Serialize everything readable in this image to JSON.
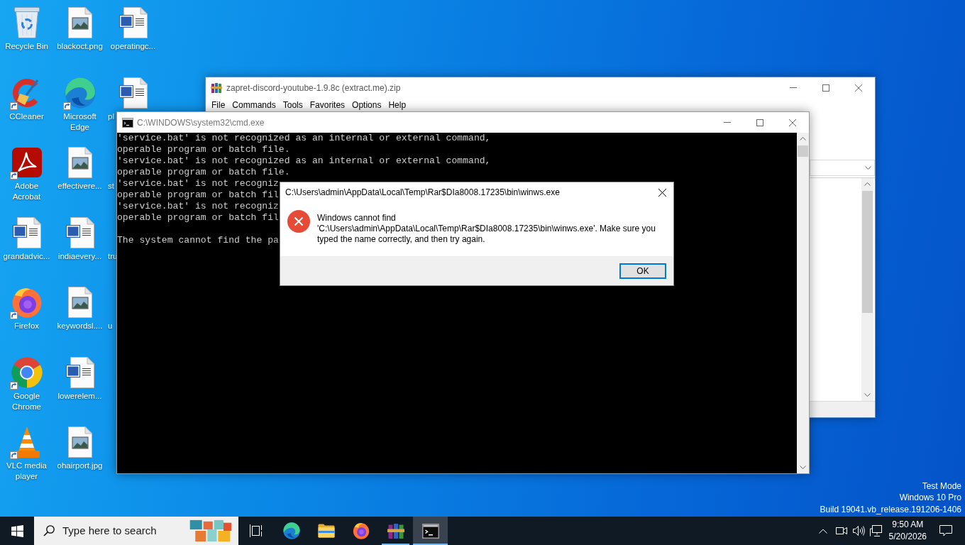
{
  "desktop": {
    "icons": [
      {
        "label": "Recycle Bin",
        "kind": "recycle-bin",
        "shortcut": false,
        "covered": false
      },
      {
        "label": "CCleaner",
        "kind": "ccleaner",
        "shortcut": true,
        "covered": false
      },
      {
        "label": "Adobe Acrobat",
        "kind": "acrobat",
        "shortcut": true,
        "covered": false
      },
      {
        "label": "grandadvic...",
        "kind": "document",
        "shortcut": false,
        "covered": false
      },
      {
        "label": "Firefox",
        "kind": "firefox",
        "shortcut": true,
        "covered": false
      },
      {
        "label": "Google Chrome",
        "kind": "chrome",
        "shortcut": true,
        "covered": false
      },
      {
        "label": "VLC media player",
        "kind": "vlc",
        "shortcut": true,
        "covered": false
      },
      {
        "label": "blackoct.png",
        "kind": "image",
        "shortcut": false,
        "covered": false
      },
      {
        "label": "Microsoft Edge",
        "kind": "edge",
        "shortcut": true,
        "covered": false
      },
      {
        "label": "effectivere...",
        "kind": "image",
        "shortcut": false,
        "covered": false
      },
      {
        "label": "indiaevery...",
        "kind": "document",
        "shortcut": false,
        "covered": false
      },
      {
        "label": "keywordsl....",
        "kind": "image",
        "shortcut": false,
        "covered": false
      },
      {
        "label": "lowerelem...",
        "kind": "document",
        "shortcut": false,
        "covered": false
      },
      {
        "label": "ohairport.jpg",
        "kind": "image",
        "shortcut": false,
        "covered": false
      },
      {
        "label": "operatingc...",
        "kind": "document",
        "shortcut": false,
        "covered": false
      },
      {
        "label": "pl",
        "kind": "document",
        "shortcut": false,
        "covered": true
      },
      {
        "label": "st",
        "kind": "unknown",
        "shortcut": false,
        "covered": true
      },
      {
        "label": "tru",
        "kind": "unknown",
        "shortcut": false,
        "covered": true
      },
      {
        "label": "u",
        "kind": "unknown",
        "shortcut": false,
        "covered": true
      }
    ],
    "system_info": [
      "Test Mode",
      "Windows 10 Pro",
      "Build 19041.vb_release.191206-1406"
    ]
  },
  "archive_window": {
    "title": "zapret-discord-youtube-1.9.8c (extract.me).zip",
    "active": false,
    "menu": [
      "File",
      "Commands",
      "Tools",
      "Favorites",
      "Options",
      "Help"
    ]
  },
  "console_window": {
    "title": "C:\\WINDOWS\\system32\\cmd.exe",
    "active": false,
    "output": [
      {
        "lines": [
          "'service.bat' is not recognized as an internal or external command,",
          "operable program or batch file.",
          "'service.bat' is not recognized as an internal or external command,",
          "operable program or batch file.",
          "'service.bat' is not recogniz",
          "operable program or batch fil",
          "'service.bat' is not recogniz",
          "operable program or batch fil"
        ]
      },
      {
        "lines": [
          "The system cannot find the pa"
        ]
      }
    ]
  },
  "error_dialog": {
    "title": "C:\\Users\\admin\\AppData\\Local\\Temp\\Rar$DIa8008.17235\\bin\\winws.exe",
    "active": true,
    "message": "Windows cannot find 'C:\\Users\\admin\\AppData\\Local\\Temp\\Rar$DIa8008.17235\\bin\\winws.exe'. Make sure you typed the name correctly, and then try again.",
    "buttons": [
      {
        "label": "OK",
        "focused": true
      }
    ]
  },
  "taskbar": {
    "search": {
      "placeholder": "Type here to search"
    },
    "apps": [
      {
        "kind": "task-view",
        "running": false,
        "active": false
      },
      {
        "kind": "edge",
        "running": false,
        "active": false
      },
      {
        "kind": "explorer",
        "running": false,
        "active": false
      },
      {
        "kind": "firefox",
        "running": false,
        "active": false
      },
      {
        "kind": "winrar",
        "running": true,
        "active": false
      },
      {
        "kind": "terminal",
        "running": true,
        "active": true
      }
    ],
    "clock": {
      "time": "9:50 AM",
      "date": "5/20/2026"
    }
  }
}
